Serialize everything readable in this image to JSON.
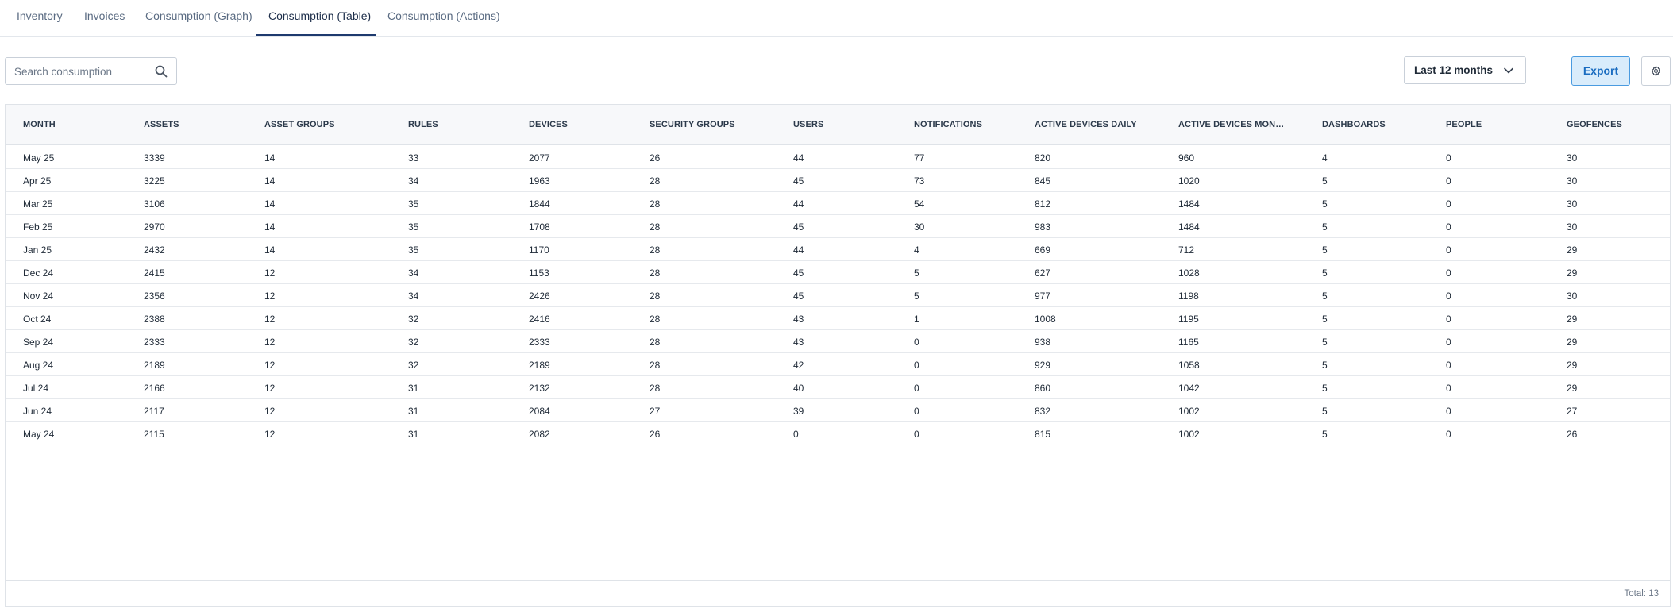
{
  "tabs": [
    {
      "label": "Inventory"
    },
    {
      "label": "Invoices"
    },
    {
      "label": "Consumption (Graph)"
    },
    {
      "label": "Consumption (Table)"
    },
    {
      "label": "Consumption (Actions)"
    }
  ],
  "active_tab": "Consumption (Table)",
  "search": {
    "placeholder": "Search consumption",
    "value": ""
  },
  "period": {
    "selected": "Last 12 months"
  },
  "export_label": "Export",
  "icons": {
    "search": "search-icon",
    "chevron": "chevron-down-icon",
    "settings": "gear-icon"
  },
  "colors": {
    "accent": "#1a6cc0",
    "export_bg": "#d9ecfb",
    "tab_active": "#1e3a6e"
  },
  "table": {
    "columns": [
      "MONTH",
      "ASSETS",
      "ASSET GROUPS",
      "RULES",
      "DEVICES",
      "SECURITY GROUPS",
      "USERS",
      "NOTIFICATIONS",
      "ACTIVE DEVICES DAILY",
      "ACTIVE DEVICES MON…",
      "DASHBOARDS",
      "PEOPLE",
      "GEOFENCES"
    ],
    "rows": [
      [
        "May 25",
        "3339",
        "14",
        "33",
        "2077",
        "26",
        "44",
        "77",
        "820",
        "960",
        "4",
        "0",
        "30"
      ],
      [
        "Apr 25",
        "3225",
        "14",
        "34",
        "1963",
        "28",
        "45",
        "73",
        "845",
        "1020",
        "5",
        "0",
        "30"
      ],
      [
        "Mar 25",
        "3106",
        "14",
        "35",
        "1844",
        "28",
        "44",
        "54",
        "812",
        "1484",
        "5",
        "0",
        "30"
      ],
      [
        "Feb 25",
        "2970",
        "14",
        "35",
        "1708",
        "28",
        "45",
        "30",
        "983",
        "1484",
        "5",
        "0",
        "30"
      ],
      [
        "Jan 25",
        "2432",
        "14",
        "35",
        "1170",
        "28",
        "44",
        "4",
        "669",
        "712",
        "5",
        "0",
        "29"
      ],
      [
        "Dec 24",
        "2415",
        "12",
        "34",
        "1153",
        "28",
        "45",
        "5",
        "627",
        "1028",
        "5",
        "0",
        "29"
      ],
      [
        "Nov 24",
        "2356",
        "12",
        "34",
        "2426",
        "28",
        "45",
        "5",
        "977",
        "1198",
        "5",
        "0",
        "30"
      ],
      [
        "Oct 24",
        "2388",
        "12",
        "32",
        "2416",
        "28",
        "43",
        "1",
        "1008",
        "1195",
        "5",
        "0",
        "29"
      ],
      [
        "Sep 24",
        "2333",
        "12",
        "32",
        "2333",
        "28",
        "43",
        "0",
        "938",
        "1165",
        "5",
        "0",
        "29"
      ],
      [
        "Aug 24",
        "2189",
        "12",
        "32",
        "2189",
        "28",
        "42",
        "0",
        "929",
        "1058",
        "5",
        "0",
        "29"
      ],
      [
        "Jul 24",
        "2166",
        "12",
        "31",
        "2132",
        "28",
        "40",
        "0",
        "860",
        "1042",
        "5",
        "0",
        "29"
      ],
      [
        "Jun 24",
        "2117",
        "12",
        "31",
        "2084",
        "27",
        "39",
        "0",
        "832",
        "1002",
        "5",
        "0",
        "27"
      ],
      [
        "May 24",
        "2115",
        "12",
        "31",
        "2082",
        "26",
        "0",
        "0",
        "815",
        "1002",
        "5",
        "0",
        "26"
      ]
    ],
    "total_label": "Total: 13"
  }
}
